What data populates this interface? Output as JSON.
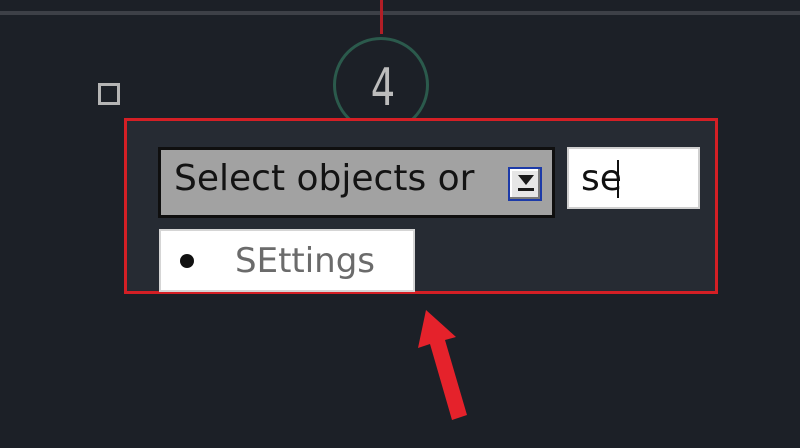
{
  "step": {
    "number": "4"
  },
  "command_line": {
    "prompt_label": "Select objects or",
    "input_value": "se",
    "dropdown_icon": "dropdown-arrow-icon"
  },
  "autocomplete": {
    "suggestion_label": "SEttings",
    "bullet_icon": "bullet-icon"
  },
  "colors": {
    "background": "#1c2027",
    "panel": "#262b33",
    "highlight_border": "#d41f25",
    "annotation_arrow": "#e5222b",
    "step_circle": "#2b5a4c"
  }
}
